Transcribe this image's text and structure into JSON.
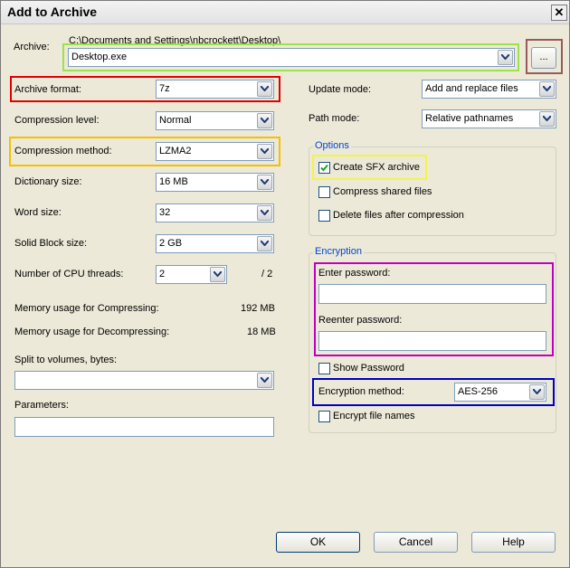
{
  "window": {
    "title": "Add to Archive",
    "close_glyph": "✕"
  },
  "archive": {
    "label": "Archive:",
    "path": "C:\\Documents and Settings\\nbcrockett\\Desktop\\",
    "filename": "Desktop.exe",
    "browse_label": "..."
  },
  "left": {
    "archive_format": {
      "label": "Archive format:",
      "value": "7z"
    },
    "compression_level": {
      "label": "Compression level:",
      "value": "Normal"
    },
    "compression_method": {
      "label": "Compression method:",
      "value": "LZMA2"
    },
    "dictionary_size": {
      "label": "Dictionary size:",
      "value": "16 MB"
    },
    "word_size": {
      "label": "Word size:",
      "value": "32"
    },
    "solid_block_size": {
      "label": "Solid Block size:",
      "value": "2 GB"
    },
    "cpu_threads": {
      "label": "Number of CPU threads:",
      "value": "2",
      "max": "/ 2"
    },
    "mem_compress": {
      "label": "Memory usage for Compressing:",
      "value": "192 MB"
    },
    "mem_decompress": {
      "label": "Memory usage for Decompressing:",
      "value": "18 MB"
    },
    "split": {
      "label": "Split to volumes, bytes:",
      "value": ""
    },
    "parameters": {
      "label": "Parameters:",
      "value": ""
    }
  },
  "right": {
    "update_mode": {
      "label": "Update mode:",
      "value": "Add and replace files"
    },
    "path_mode": {
      "label": "Path mode:",
      "value": "Relative pathnames"
    },
    "options": {
      "title": "Options",
      "create_sfx": {
        "label": "Create SFX archive",
        "checked": true
      },
      "compress_shared": {
        "label": "Compress shared files",
        "checked": false
      },
      "delete_after": {
        "label": "Delete files after compression",
        "checked": false
      }
    },
    "encryption": {
      "title": "Encryption",
      "enter_password_label": "Enter password:",
      "reenter_password_label": "Reenter password:",
      "show_password": {
        "label": "Show Password",
        "checked": false
      },
      "method": {
        "label": "Encryption method:",
        "value": "AES-256"
      },
      "encrypt_names": {
        "label": "Encrypt file names",
        "checked": false
      }
    }
  },
  "buttons": {
    "ok": "OK",
    "cancel": "Cancel",
    "help": "Help"
  },
  "highlight_colors": {
    "archive_name": "#9be347",
    "browse": "#9b5a5a",
    "archive_format": "#e00000",
    "compression_method": "#f5c000",
    "create_sfx": "#f3f34a",
    "passwords": "#c000c0",
    "encryption_method": "#0000c0"
  }
}
